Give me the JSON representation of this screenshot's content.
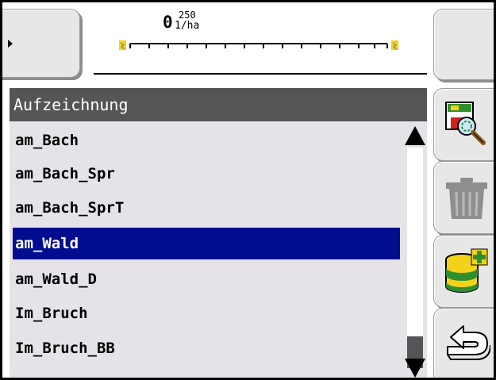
{
  "gauge": {
    "value": "0",
    "max": "250",
    "unit": "1/ha",
    "level": 0
  },
  "list": {
    "title": "Aufzeichnung",
    "items": [
      "am_Bach",
      "am_Bach_Spr",
      "am_Bach_SprT",
      "am_Wald",
      "am_Wald_D",
      "Im_Bruch",
      "Im_Bruch_BB"
    ],
    "selected": "am_Wald"
  },
  "softkeys": {
    "left_icon": "arrow-right-icon",
    "right": [
      "search-recording-icon",
      "trash-icon",
      "import-database-icon",
      "back-icon"
    ]
  },
  "colors": {
    "selection": "#000d8f",
    "header": "#555555",
    "list_background": "#e5e3e8",
    "gauge_marker": "#f3d219"
  }
}
